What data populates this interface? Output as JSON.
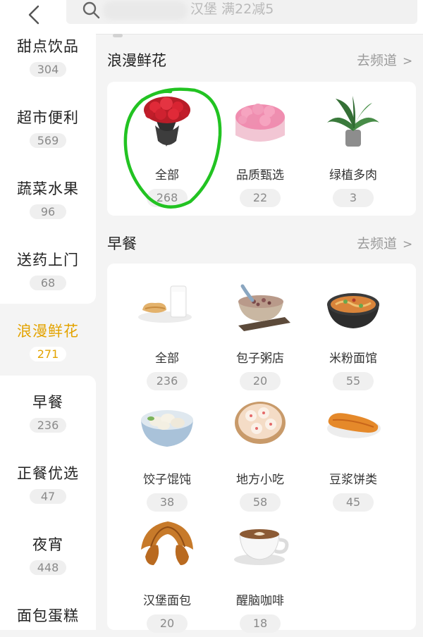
{
  "search": {
    "placeholder": "汉堡 满22减5"
  },
  "sidebar": {
    "items": [
      {
        "label": "甜点饮品",
        "count": "304"
      },
      {
        "label": "超市便利",
        "count": "569"
      },
      {
        "label": "蔬菜水果",
        "count": "96"
      },
      {
        "label": "送药上门",
        "count": "68"
      },
      {
        "label": "浪漫鲜花",
        "count": "271",
        "active": true
      },
      {
        "label": "早餐",
        "count": "236"
      },
      {
        "label": "正餐优选",
        "count": "47"
      },
      {
        "label": "夜宵",
        "count": "448"
      },
      {
        "label": "面包蛋糕",
        "count": ""
      }
    ]
  },
  "sections": [
    {
      "title": "浪漫鲜花",
      "link": "去频道",
      "link_arrow": ">",
      "items": [
        {
          "label": "全部",
          "count": "268",
          "icon": "rose-bouquet-icon"
        },
        {
          "label": "品质甄选",
          "count": "22",
          "icon": "flower-box-icon"
        },
        {
          "label": "绿植多肉",
          "count": "3",
          "icon": "potted-plant-icon"
        }
      ]
    },
    {
      "title": "早餐",
      "link": "去频道",
      "link_arrow": ">",
      "items": [
        {
          "label": "全部",
          "count": "236",
          "icon": "bread-milk-icon"
        },
        {
          "label": "包子粥店",
          "count": "20",
          "icon": "porridge-bowl-icon"
        },
        {
          "label": "米粉面馆",
          "count": "55",
          "icon": "noodle-bowl-icon"
        },
        {
          "label": "饺子馄饨",
          "count": "38",
          "icon": "dumpling-bowl-icon"
        },
        {
          "label": "地方小吃",
          "count": "58",
          "icon": "dim-sum-steamer-icon"
        },
        {
          "label": "豆浆饼类",
          "count": "45",
          "icon": "fried-dough-icon"
        },
        {
          "label": "汉堡面包",
          "count": "20",
          "icon": "croissant-icon"
        },
        {
          "label": "醒脑咖啡",
          "count": "18",
          "icon": "coffee-cup-icon"
        }
      ]
    }
  ],
  "colors": {
    "accent": "#e3a300",
    "annotation": "#22c322",
    "background": "#f4f4f4"
  }
}
